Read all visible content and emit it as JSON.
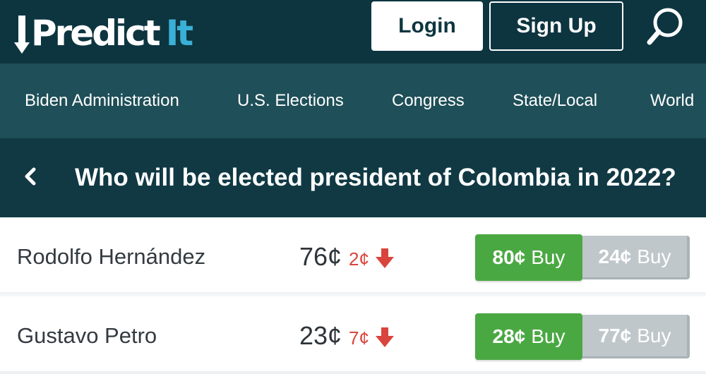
{
  "header": {
    "logo": {
      "predict": "Predict",
      "it": "It",
      "accent_color": "#39b0d6"
    },
    "login_label": "Login",
    "signup_label": "Sign Up",
    "search_icon": "search-icon",
    "background": "#0d3540"
  },
  "nav": {
    "items": [
      {
        "label": "Biden Administration"
      },
      {
        "label": "U.S. Elections"
      },
      {
        "label": "Congress"
      },
      {
        "label": "State/Local"
      },
      {
        "label": "World"
      }
    ]
  },
  "market": {
    "back_icon": "chevron-left-icon",
    "title": "Who will be elected president of Colombia in 2022?"
  },
  "contracts": [
    {
      "name": "Rodolfo Hernández",
      "price": "76¢",
      "change": "2¢",
      "change_direction": "down",
      "buy_yes_price": "80¢",
      "buy_yes_label": "Buy",
      "buy_no_price": "24¢",
      "buy_no_label": "Buy"
    },
    {
      "name": "Gustavo Petro",
      "price": "23¢",
      "change": "7¢",
      "change_direction": "down",
      "buy_yes_price": "28¢",
      "buy_yes_label": "Buy",
      "buy_no_price": "77¢",
      "buy_no_label": "Buy"
    }
  ],
  "colors": {
    "yes_green": "#4aa843",
    "no_gray": "#bfc7cb",
    "down_red": "#d9453d",
    "nav_bg": "#1f4f58",
    "title_bg": "#103944"
  }
}
